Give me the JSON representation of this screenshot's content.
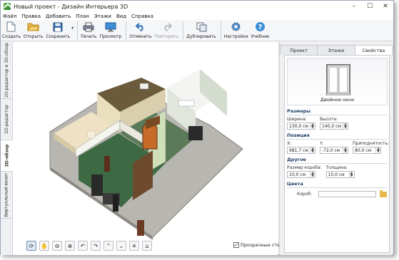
{
  "window": {
    "title": "Новый проект - Дизайн Интерьера 3D",
    "minimize": "–",
    "maximize": "☐",
    "close": "✕"
  },
  "menu": [
    "Файл",
    "Правка",
    "Добавить",
    "План",
    "Этажи",
    "Вид",
    "Справка"
  ],
  "toolbar": {
    "create": "Создать",
    "open": "Открыть",
    "save": "Сохранить",
    "save_dropdown": "▾",
    "print": "Печать",
    "preview": "Просмотр",
    "undo": "Отменить",
    "redo": "Повторить",
    "duplicate": "Дублировать",
    "settings": "Настройки",
    "tutorial": "Учебник"
  },
  "left_tabs": [
    "2D-редактор и 3D-обзор",
    "2D-редактор",
    "3D-обзор",
    "Виртуальный визит"
  ],
  "view_tools": {
    "icons": [
      "rotate-icon",
      "hand-icon",
      "zoom-out-icon",
      "zoom-in-icon",
      "rotate-left-icon",
      "rotate-right-icon",
      "tilt-up-icon",
      "tilt-down-icon",
      "lightbulb-icon",
      "home-icon"
    ],
    "transparent_walls_label": "Прозрачные стены",
    "transparent_walls_checked": "✓"
  },
  "right_panel": {
    "tabs": [
      "Проект",
      "Этажи",
      "Свойства"
    ],
    "active_tab": "Свойства",
    "object_name": "Двойное окно",
    "sections": {
      "size": {
        "title": "Размеры",
        "width_label": "Ширина:",
        "width_value": "130,0 см",
        "height_label": "Высота:",
        "height_value": "140,0 см"
      },
      "position": {
        "title": "Позиция",
        "x_label": "X:",
        "x_value": "981,7 см",
        "y_label": "Y:",
        "y_value": "-72,0 см",
        "sill_label": "Приподнятость:",
        "sill_value": "80,0 см"
      },
      "other": {
        "title": "Другое",
        "box_label": "Размер короба:",
        "box_value": "10,0 см",
        "thickness_label": "Толщина:",
        "thickness_value": "10,0 см"
      },
      "color": {
        "title": "Цвета",
        "box_label": "Короб:"
      }
    }
  }
}
